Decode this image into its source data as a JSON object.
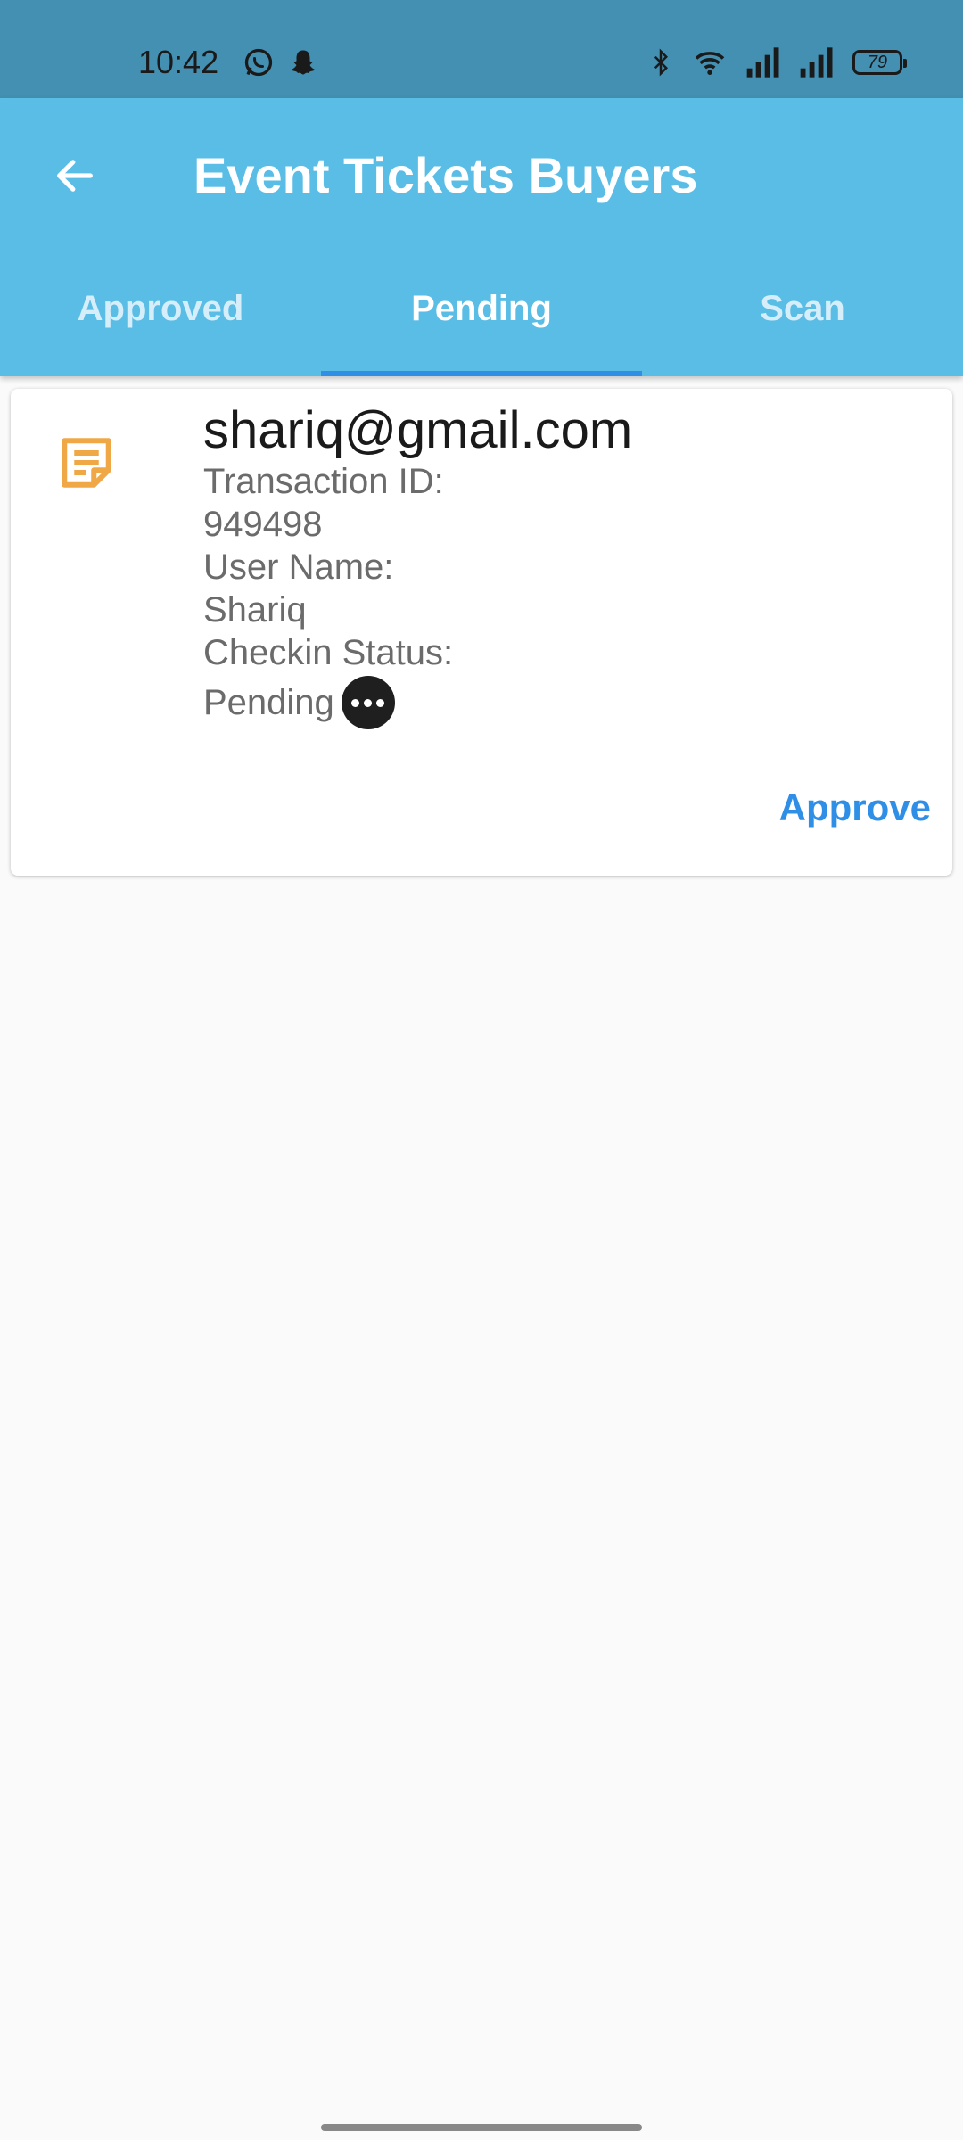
{
  "status_bar": {
    "time": "10:42",
    "battery": "79",
    "left_icons": [
      "whatsapp-icon",
      "snapchat-icon"
    ],
    "right_icons": [
      "bluetooth-icon",
      "wifi-icon",
      "signal-icon",
      "signal-icon",
      "battery-icon"
    ]
  },
  "app_bar": {
    "title": "Event Tickets Buyers",
    "back_icon": "arrow-back-icon",
    "background": "#59bde6"
  },
  "tabs": [
    {
      "label": "Approved",
      "active": false
    },
    {
      "label": "Pending",
      "active": true
    },
    {
      "label": "Scan",
      "active": false
    }
  ],
  "ticket": {
    "email": "shariq@gmail.com",
    "transaction_label": "Transaction ID:",
    "transaction_id": "949498",
    "user_name_label": "User Name:",
    "user_name": "Shariq",
    "checkin_label": "Checkin Status:",
    "checkin_status": "Pending",
    "icon": "note-icon",
    "status_icon": "more-horiz-icon",
    "approve_label": "Approve"
  },
  "colors": {
    "accent": "#2f8fe6",
    "icon": "#f0a847",
    "status_bar": "#4490b2"
  }
}
